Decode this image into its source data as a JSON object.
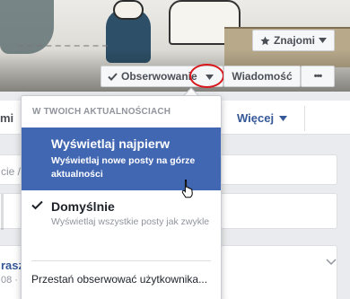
{
  "cover": {
    "friends_label": "Znajomi",
    "observing_label": "Obserwowanie",
    "message_label": "Wiadomość",
    "more_label": "•••"
  },
  "nav": {
    "left_fragment": "mi",
    "more_label": "Więcej"
  },
  "background": {
    "card_a_fragment": "cie / l",
    "card_c_fragment": "rasz",
    "card_c_sub_fragment": "08 ·"
  },
  "menu": {
    "header": "W TWOICH AKTUALNOŚCIACH",
    "items": [
      {
        "title": "Wyświetlaj najpierw",
        "description": "Wyświetlaj nowe posty na górze aktualności",
        "highlighted": true
      },
      {
        "title": "Domyślnie",
        "description": "Wyświetlaj wszystkie posty jak zwykle",
        "checked": true
      }
    ],
    "unfollow": "Przestań obserwować użytkownika..."
  },
  "colors": {
    "accent": "#4267b2",
    "link": "#365899",
    "annotation_ring": "#d8171c"
  },
  "icons": {
    "friends": "star-icon",
    "observing": "checkmark-icon",
    "caret": "caret-down-icon",
    "more": "ellipsis-icon",
    "cursor": "hand-pointer-icon",
    "chevron": "chevron-down-icon"
  }
}
